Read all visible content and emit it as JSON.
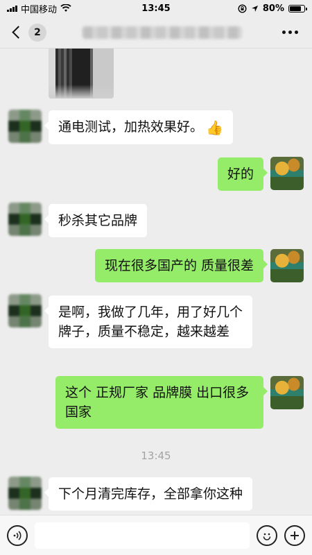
{
  "status_bar": {
    "carrier": "中国移动",
    "time": "13:45",
    "battery": "80%",
    "battery_level": 0.8,
    "icons": [
      "signal-icon",
      "wifi-icon",
      "orientation-lock-icon",
      "location-icon",
      "battery-icon"
    ]
  },
  "nav": {
    "unread_count": "2",
    "title_state": "blurred"
  },
  "messages": [
    {
      "side": "left",
      "type": "image",
      "content": "photo"
    },
    {
      "side": "left",
      "type": "text",
      "text": "通电测试，加热效果好。",
      "emoji": "👍"
    },
    {
      "side": "right",
      "type": "text",
      "text": "好的"
    },
    {
      "side": "left",
      "type": "text",
      "text": "秒杀其它品牌"
    },
    {
      "side": "right",
      "type": "text",
      "text": "现在很多国产的 质量很差"
    },
    {
      "side": "left",
      "type": "text",
      "text": "是啊，我做了几年，用了好几个牌子，质量不稳定，越来越差"
    },
    {
      "side": "right",
      "type": "text",
      "text": "这个 正规厂家 品牌膜 出口很多国家"
    },
    {
      "side": "left",
      "type": "text",
      "text": "下个月清完库存，全部拿你这种"
    }
  ],
  "timestamp": "13:45",
  "input_bar": {
    "icons": [
      "voice-icon",
      "emoji-icon",
      "plus-icon"
    ]
  },
  "colors": {
    "background": "#ededed",
    "sent_bubble": "#95ec69",
    "received_bubble": "#ffffff"
  }
}
